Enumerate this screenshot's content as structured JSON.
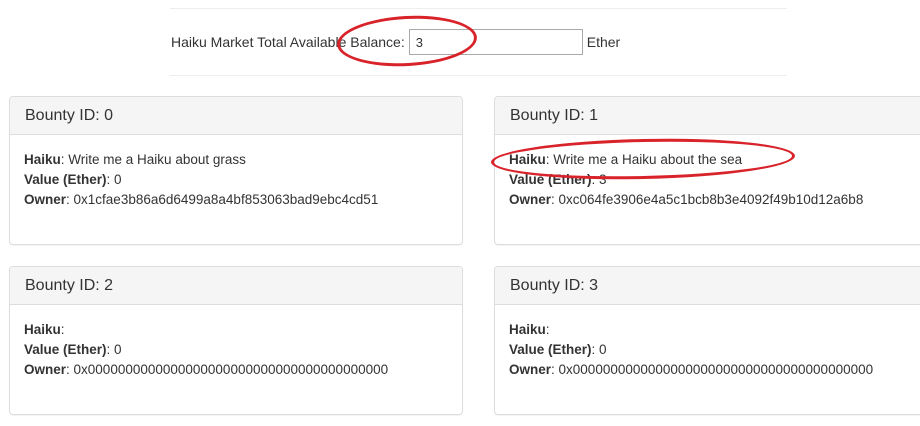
{
  "balance": {
    "label": "Haiku Market Total Available Balance:",
    "value": "3",
    "unit": "Ether"
  },
  "field_labels": {
    "haiku": "Haiku",
    "value": "Value (Ether)",
    "owner": "Owner",
    "separator": ":"
  },
  "bounties": [
    {
      "title": "Bounty ID: 0",
      "haiku": " Write me a Haiku about grass",
      "value": " 0",
      "owner": " 0x1cfae3b86a6d6499a8a4bf853063bad9ebc4cd51"
    },
    {
      "title": "Bounty ID: 1",
      "haiku": " Write me a Haiku about the sea",
      "value": " 3",
      "owner": " 0xc064fe3906e4a5c1bcb8b3e4092f49b10d12a6b8"
    },
    {
      "title": "Bounty ID: 2",
      "haiku": "",
      "value": " 0",
      "owner": " 0x0000000000000000000000000000000000000000"
    },
    {
      "title": "Bounty ID: 3",
      "haiku": "",
      "value": " 0",
      "owner": " 0x0000000000000000000000000000000000000000"
    }
  ],
  "colors": {
    "annotation": "#d9232a",
    "panel_heading_bg": "#f5f5f5",
    "panel_border": "#dddddd"
  }
}
